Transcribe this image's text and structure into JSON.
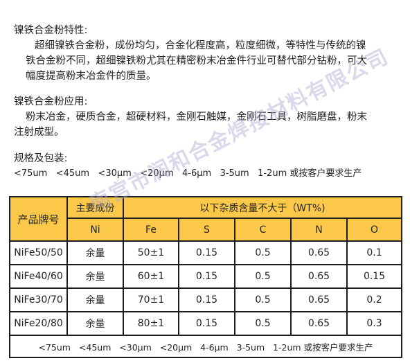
{
  "properties": {
    "title": "镍铁合金粉特性:",
    "lines": [
      "超细镍铁合金粉，成份均匀，合金化程度高，粒度细微，等特性与传统的镍",
      "铁合金粉不同，超细镍铁粉尤其在精密粉末冶金件行业可替代部分钴粉，可大",
      "幅度提高粉末冶金件的质量。"
    ]
  },
  "applications": {
    "title": "镍铁合金粉应用:",
    "lines": [
      "粉末冶金，硬质合金，超硬材料，金刚石触媒，金刚石工具，树脂磨盘，粉末",
      "注射成型。"
    ]
  },
  "packaging": {
    "title": "规格及包装:",
    "sizes": "<75um   <45um   <30μm   <20μm   4-6μm   3-5um   1-2um 或按客户要求生产"
  },
  "table": {
    "product_header": "产品牌号",
    "main_component_header": "主要成份",
    "impurity_header": "以下杂质含量不大于（WT%)",
    "columns": [
      "Ni",
      "Fe",
      "S",
      "C",
      "N",
      "O"
    ],
    "rows": [
      {
        "name": "NiFe50/50",
        "ni": "余量",
        "fe": "50±1",
        "s": "0.15",
        "c": "0.5",
        "n": "0.65",
        "o": "0.1"
      },
      {
        "name": "NiFe40/60",
        "ni": "余量",
        "fe": "60±1",
        "s": "0.15",
        "c": "0.5",
        "n": "0.65",
        "o": "0.15"
      },
      {
        "name": "NiFe30/70",
        "ni": "余量",
        "fe": "70±1",
        "s": "0.15",
        "c": "0.5",
        "n": "0.65",
        "o": "0.2"
      },
      {
        "name": "NiFe20/80",
        "ni": "余量",
        "fe": "80±1",
        "s": "0.15",
        "c": "0.5",
        "n": "0.65",
        "o": "0.3"
      }
    ],
    "footer": "<75um   <45um   <30μm   <20μm   4-6μm   3-5um   1-2um 或按客户要求生产"
  },
  "watermark": "南宫市润和合金焊接材料有限公司",
  "colors": {
    "header_bg": "#fbc84a",
    "border": "#1c1c1c",
    "watermark": "#aaaad2"
  }
}
